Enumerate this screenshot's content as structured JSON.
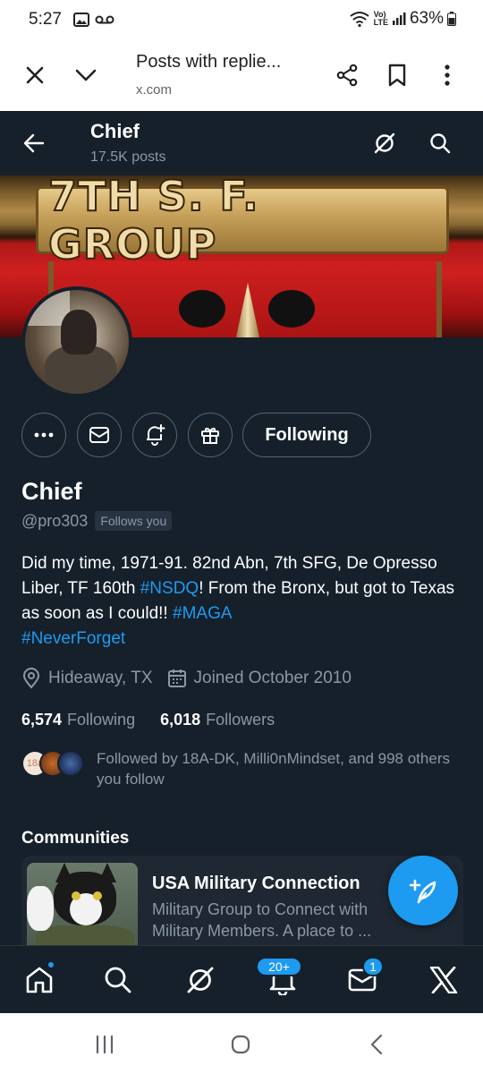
{
  "status_bar": {
    "time": "5:27",
    "battery": "63%",
    "network_label_top": "Vo)",
    "network_label_bottom": "LTE"
  },
  "browser": {
    "title": "Posts with replie...",
    "url": "x.com"
  },
  "profile_header": {
    "name": "Chief",
    "posts": "17.5K posts"
  },
  "banner": {
    "text": "7TH S. F. GROUP"
  },
  "actions": {
    "following_label": "Following"
  },
  "profile": {
    "name": "Chief",
    "handle": "@pro303",
    "follows_you": "Follows you",
    "bio_parts": {
      "p1": "Did my time, 1971-91. 82nd Abn, 7th SFG, De Opresso Liber, TF 160th ",
      "tag1": "#NSDQ",
      "p2": "! From the Bronx, but got to Texas as soon as I could!! ",
      "tag2": "#MAGA",
      "tag3": "#NeverForget"
    },
    "location": "Hideaway, TX",
    "joined": "Joined October 2010",
    "following_count": "6,574",
    "following_label": "Following",
    "followers_count": "6,018",
    "followers_label": "Followers",
    "followed_by_avatar_label": "18a",
    "followed_by": "Followed by 18A-DK, Milli0nMindset, and 998 others you follow"
  },
  "communities": {
    "title": "Communities",
    "card": {
      "name": "USA Military Connection",
      "description": "Military Group to Connect with Military Members. A place to ..."
    }
  },
  "tabbar": {
    "notifications_badge": "20+",
    "messages_badge": "1"
  },
  "colors": {
    "background": "#15202b",
    "accent": "#1d9bf0",
    "secondary_text": "#8b98a5"
  }
}
